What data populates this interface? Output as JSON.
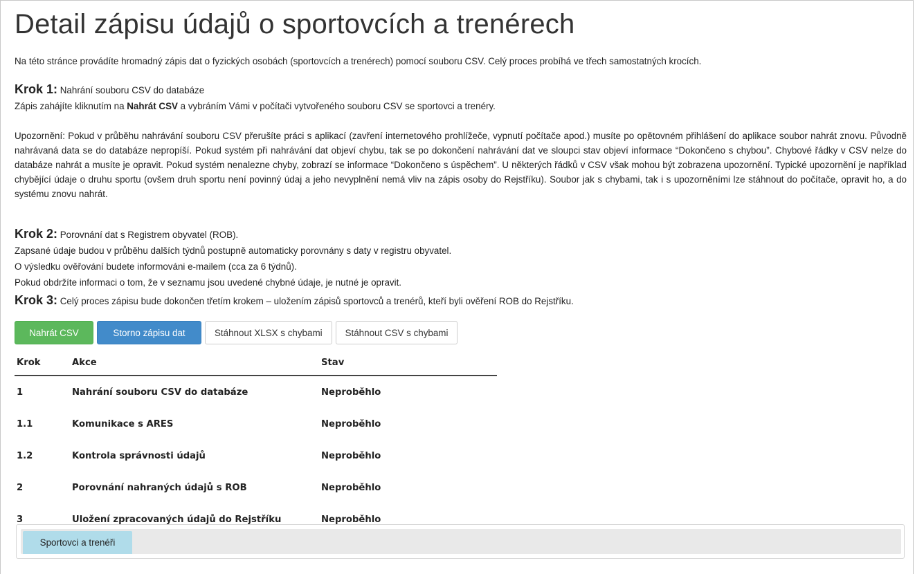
{
  "page": {
    "title": "Detail zápisu údajů o sportovcích a trenérech",
    "intro": "Na této stránce provádíte hromadný zápis dat o fyzických osobách (sportovcích a trenérech) pomocí souboru CSV. Celý proces probíhá ve třech samostatných krocích."
  },
  "step1": {
    "heading": "Krok 1:",
    "subtitle": "Nahrání souboru CSV do databáze",
    "line_before": "Zápis zahájíte kliknutím na ",
    "line_bold": "Nahrát CSV",
    "line_after": " a vybráním Vámi v počítači vytvořeného souboru CSV se sportovci a trenéry.",
    "warning": "Upozornění: Pokud v průběhu nahrávání souboru CSV přerušíte práci s aplikací (zavření internetového prohlížeče, vypnutí počítače apod.) musíte po opětovném přihlášení do aplikace soubor nahrát znovu. Původně nahrávaná data se do databáze nepropíší. Pokud systém při nahrávání dat objeví chybu, tak se po dokončení nahrávání dat ve sloupci stav objeví informace “Dokončeno s chybou”. Chybové řádky v CSV nelze do databáze nahrát a musíte je opravit. Pokud systém nenalezne chyby, zobrazí se informace “Dokončeno s úspěchem”. U některých řádků v CSV však mohou být zobrazena upozornění. Typické upozornění je například chybějící údaje o druhu sportu (ovšem druh sportu není povinný údaj a jeho nevyplnění nemá vliv na zápis osoby do Rejstříku). Soubor jak s chybami, tak i s upozorněními lze stáhnout do počítače, opravit ho, a do systému znovu nahrát."
  },
  "step2": {
    "heading": "Krok 2:",
    "subtitle": "Porovnání dat s Registrem obyvatel (ROB).",
    "line1": "Zapsané údaje budou v průběhu dalších týdnů postupně automaticky porovnány s daty v registru obyvatel.",
    "line2": "O výsledku ověřování budete informováni e-mailem (cca za 6 týdnů).",
    "line3": "Pokud obdržíte informaci o tom, že v seznamu jsou uvedené chybné údaje, je nutné je opravit."
  },
  "step3": {
    "heading": "Krok 3:",
    "subtitle": "Celý proces zápisu bude dokončen třetím krokem – uložením zápisů sportovců a trenérů, kteří byli ověření ROB do Rejstříku."
  },
  "buttons": {
    "upload": "Nahrát CSV",
    "cancel": "Storno zápisu dat",
    "download_xlsx": "Stáhnout XLSX s chybami",
    "download_csv": "Stáhnout CSV s chybami"
  },
  "table": {
    "headers": [
      "Krok",
      "Akce",
      "Stav"
    ],
    "rows": [
      {
        "step": "1",
        "action": "Nahrání souboru CSV do databáze",
        "status": "Neproběhlo"
      },
      {
        "step": "1.1",
        "action": "Komunikace s ARES",
        "status": "Neproběhlo"
      },
      {
        "step": "1.2",
        "action": "Kontrola správnosti údajů",
        "status": "Neproběhlo"
      },
      {
        "step": "2",
        "action": "Porovnání nahraných údajů s ROB",
        "status": "Neproběhlo"
      },
      {
        "step": "3",
        "action": "Uložení zpracovaných údajů do Rejstříku",
        "status": "Neproběhlo"
      }
    ]
  },
  "panel": {
    "tab_label": "Sportovci a trenéři"
  },
  "colors": {
    "upload_button": "#5cb85c",
    "cancel_button": "#428bca",
    "tab_active": "#b0dcea"
  }
}
